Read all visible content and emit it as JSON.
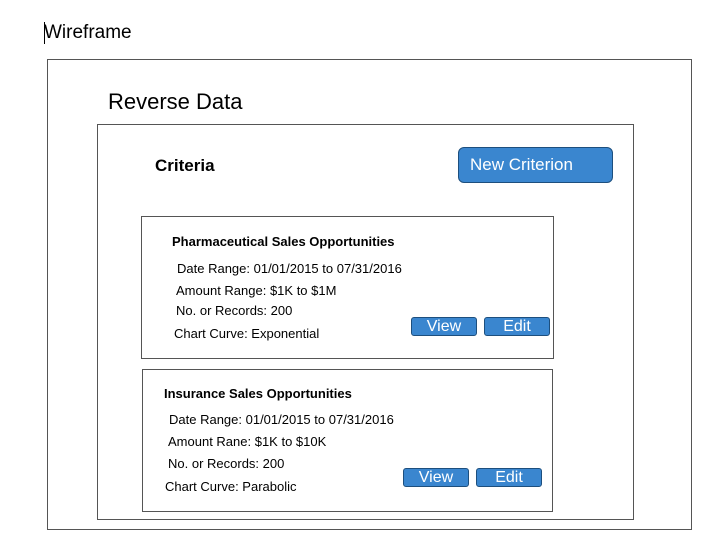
{
  "document": {
    "title": "Wireframe"
  },
  "page": {
    "heading": "Reverse Data"
  },
  "criteria": {
    "label": "Criteria",
    "new_button_label": "New Criterion",
    "items": [
      {
        "title": "Pharmaceutical Sales Opportunities",
        "date_range": "Date Range: 01/01/2015 to 07/31/2016",
        "amount_range": "Amount Range: $1K to $1M",
        "records": "No. or Records: 200",
        "chart_curve": "Chart Curve: Exponential",
        "view_label": "View",
        "edit_label": "Edit"
      },
      {
        "title": "Insurance Sales Opportunities",
        "date_range": "Date Range: 01/01/2015 to 07/31/2016",
        "amount_range": "Amount Rane: $1K to $10K",
        "records": "No. or Records: 200",
        "chart_curve": "Chart Curve: Parabolic",
        "view_label": "View",
        "edit_label": "Edit"
      }
    ]
  },
  "colors": {
    "button_fill": "#3a86cf",
    "button_border": "#1d4f7e",
    "frame_border": "#555555"
  }
}
